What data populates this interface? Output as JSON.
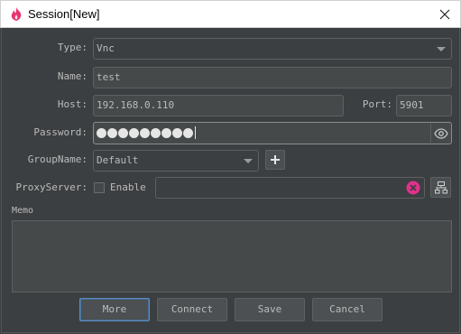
{
  "window": {
    "title": "Session[New]"
  },
  "form": {
    "type_label": "Type:",
    "type_value": "Vnc",
    "name_label": "Name:",
    "name_value": "test",
    "host_label": "Host:",
    "host_value": "192.168.0.110",
    "port_label": "Port:",
    "port_value": "5901",
    "password_label": "Password:",
    "password_mask_count": 9,
    "groupname_label": "GroupName:",
    "groupname_value": "Default",
    "proxy_label": "ProxyServer:",
    "proxy_enable_label": "Enable",
    "proxy_enabled": false,
    "proxy_value": "",
    "memo_label": "Memo",
    "memo_value": ""
  },
  "buttons": {
    "more": "More",
    "connect": "Connect",
    "save": "Save",
    "cancel": "Cancel"
  },
  "icons": {
    "app": "flame-logo-icon",
    "close": "close-icon",
    "eye": "eye-icon",
    "add": "plus-icon",
    "clear": "clear-x-icon",
    "proxy_settings": "network-icon"
  },
  "colors": {
    "background": "#3c3f41",
    "field": "#45494a",
    "accent_logo": "#e8336d",
    "clear_icon": "#e0318c",
    "focus_border": "#5b8dc4"
  }
}
